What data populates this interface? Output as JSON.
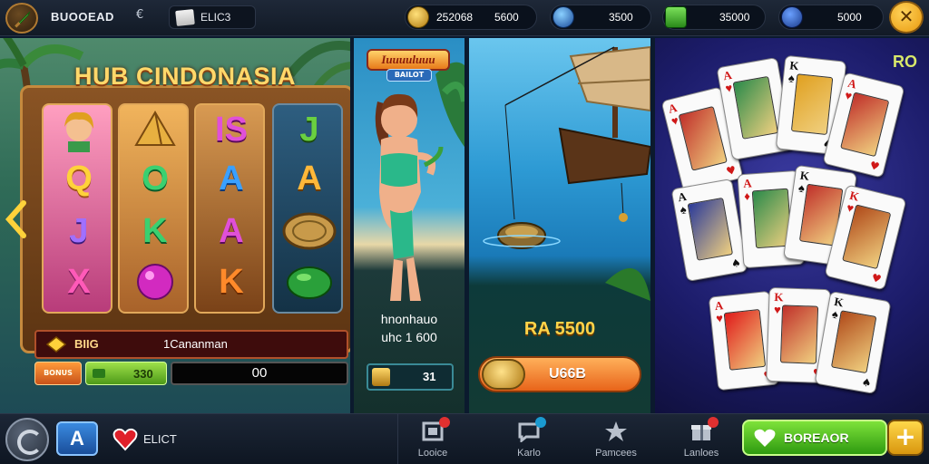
{
  "topbar": {
    "app_name": "BUOOEAD",
    "dropdown_glyph": "€",
    "search_label": "ELIC3",
    "currencies": [
      {
        "icon": "gold-coin-icon",
        "value_a": "252068",
        "value_b": "5600",
        "color": "#e8b020"
      },
      {
        "icon": "blue-gem-icon",
        "value_a": "",
        "value_b": "3500",
        "color": "#2a7ad8"
      },
      {
        "icon": "green-cash-icon",
        "value_a": "",
        "value_b": "35000",
        "color": "#3aa83a"
      },
      {
        "icon": "blue-token-icon",
        "value_a": "",
        "value_b": "5000",
        "color": "#2a5ab8"
      }
    ],
    "close_glyph": "✕"
  },
  "slots": {
    "title": "HUB CINDONASIA",
    "reels": [
      [
        "portrait",
        "Q",
        "J",
        "X"
      ],
      [
        "pyramid",
        "O",
        "K",
        "gem"
      ],
      [
        "IS",
        "A",
        "A",
        "K"
      ],
      [
        "J",
        "A",
        "coin",
        "emerald"
      ]
    ],
    "info_label": "BIIG",
    "info_text": "1Cananman",
    "bet_button": "BONUS",
    "green_value": "330",
    "bet_value": "00"
  },
  "promo_beach": {
    "logo_top": "Iuuuuluuu",
    "logo_bottom": "BAILOT",
    "line1": "hnonhauo",
    "line2": "uhc 1 600",
    "button_value": "31"
  },
  "promo_fishing": {
    "prize": "RA 5500",
    "button_label": "U66B"
  },
  "cards_panel": {
    "corner_label": "RO",
    "cards": [
      {
        "rank": "A",
        "suit": "♥",
        "color": "#d01818"
      },
      {
        "rank": "A",
        "suit": "♥",
        "color": "#d01818"
      },
      {
        "rank": "K",
        "suit": "♠",
        "color": "#111111"
      },
      {
        "rank": "A",
        "suit": "♥",
        "color": "#d01818"
      },
      {
        "rank": "A",
        "suit": "♠",
        "color": "#111111"
      },
      {
        "rank": "A",
        "suit": "♦",
        "color": "#d01818"
      },
      {
        "rank": "K",
        "suit": "♠",
        "color": "#111111"
      },
      {
        "rank": "K",
        "suit": "♥",
        "color": "#d01818"
      },
      {
        "rank": "A",
        "suit": "♥",
        "color": "#d01818"
      },
      {
        "rank": "K",
        "suit": "♥",
        "color": "#d01818"
      },
      {
        "rank": "K",
        "suit": "♠",
        "color": "#111111"
      }
    ]
  },
  "bottombar": {
    "a_label": "A",
    "heart_label": "ELICT",
    "nav": [
      {
        "label": "Looice",
        "icon": "lobby-icon"
      },
      {
        "label": "Karlo",
        "icon": "chat-icon"
      },
      {
        "label": "Pamcees",
        "icon": "star-icon"
      },
      {
        "label": "Lanloes",
        "icon": "gift-icon"
      }
    ],
    "play_label": "BOREAOR",
    "plus_glyph": "+"
  }
}
